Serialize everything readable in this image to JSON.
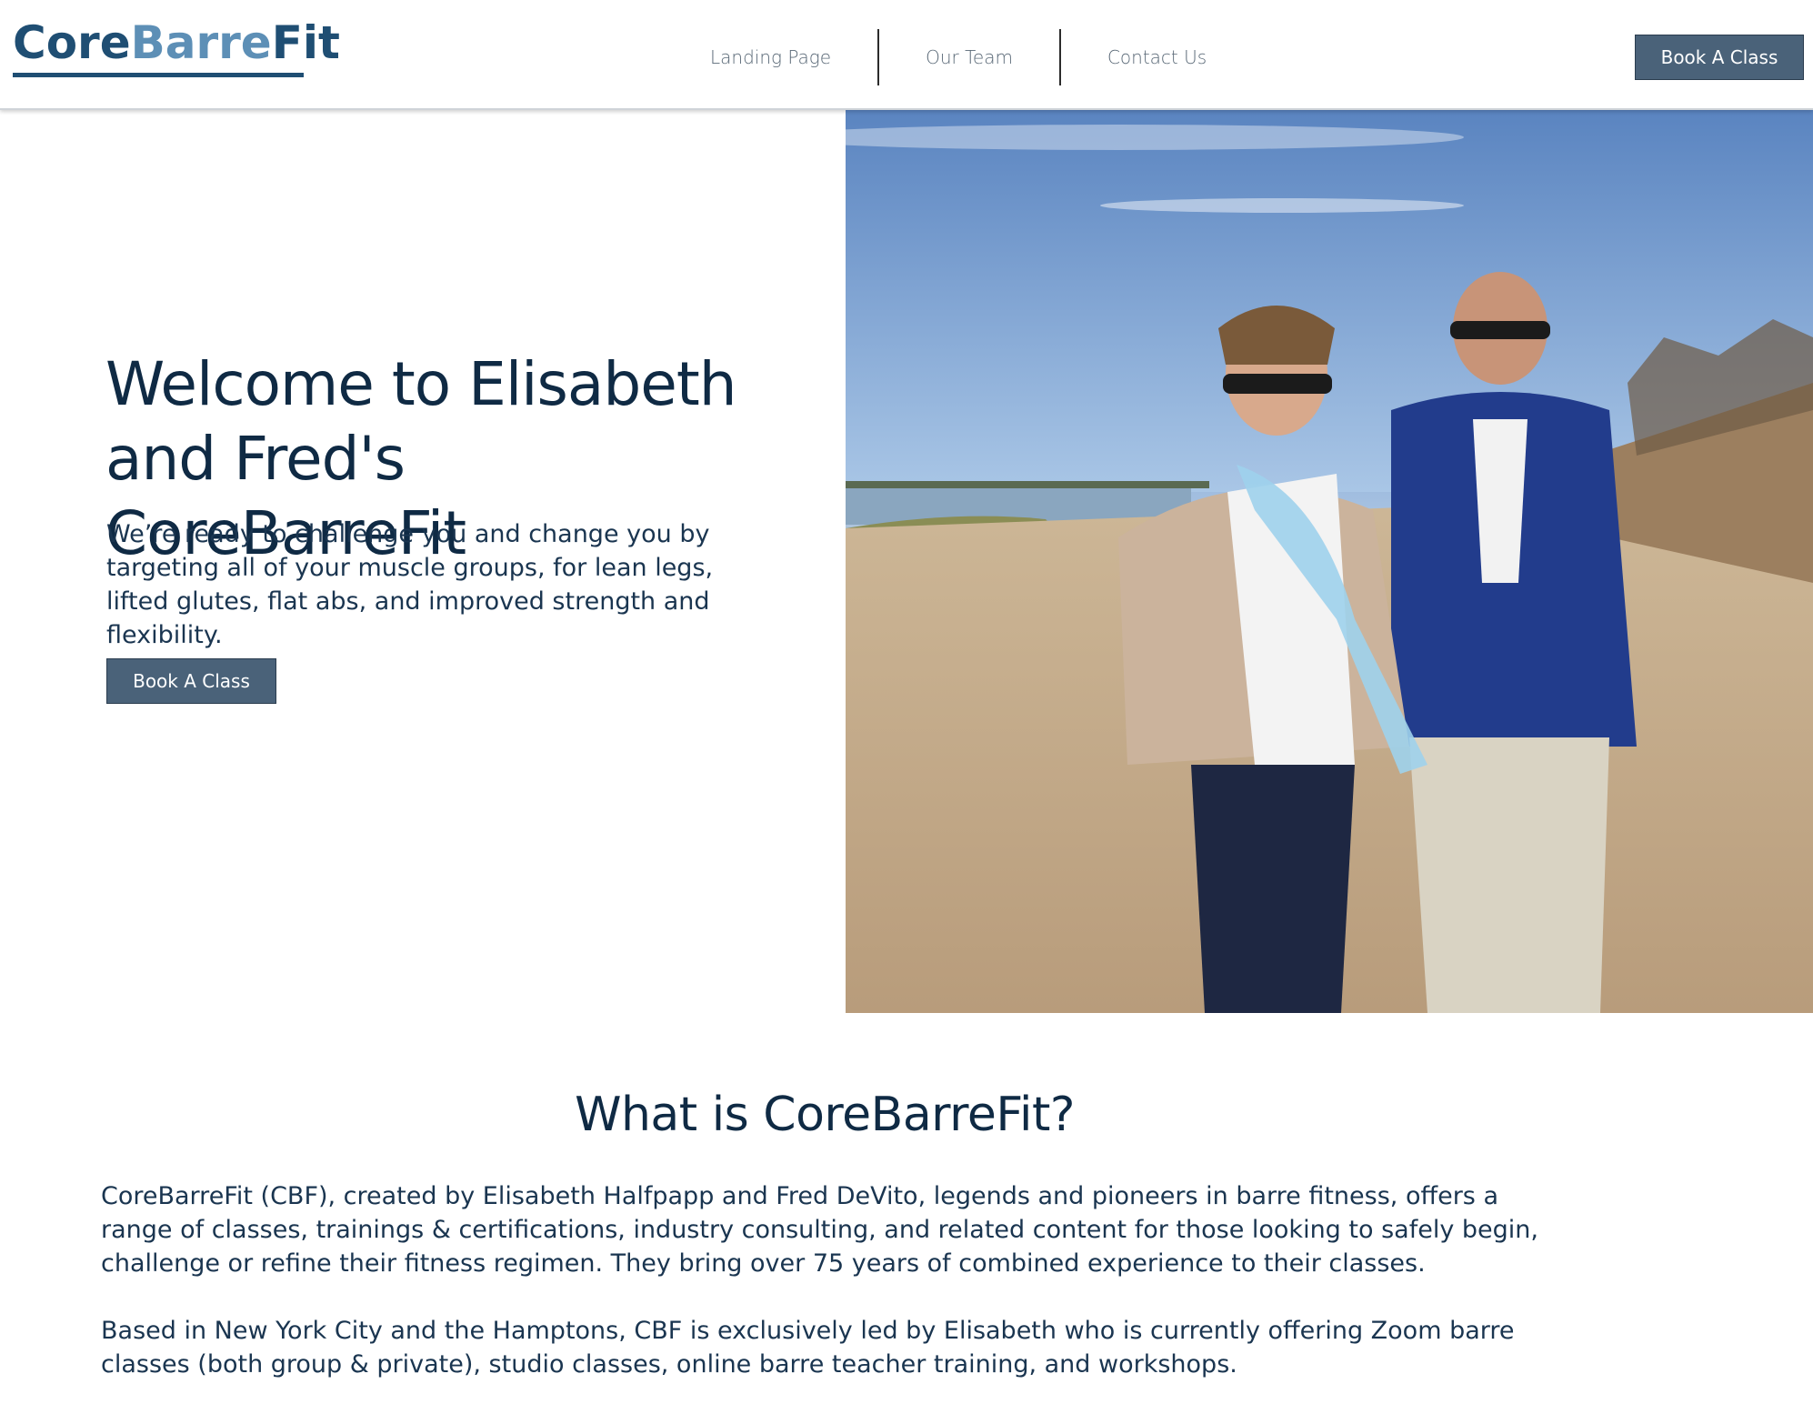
{
  "brand": {
    "logo_part1": "Core",
    "logo_part2": "Barre",
    "logo_part3": "Fit"
  },
  "nav": {
    "items": [
      {
        "label": "Landing Page"
      },
      {
        "label": "Our Team"
      },
      {
        "label": "Contact Us"
      }
    ],
    "book_label": "Book A Class"
  },
  "hero": {
    "title": "Welcome to Elisabeth and Fred's CoreBarreFit",
    "subtitle": "We’re ready to challenge you and change you by targeting all of your muscle groups, for lean legs, lifted glutes, flat abs, and improved strength and flexibility.",
    "book_label": "Book A Class"
  },
  "about": {
    "title": "What is CoreBarreFit?",
    "paragraph1": "CoreBarreFit (CBF), created by Elisabeth Halfpapp and Fred DeVito, legends and pioneers in barre fitness, offers a range of classes, trainings & certifications, industry consulting, and related content for those looking to safely begin, challenge or refine their fitness regimen. They bring over 75 years of combined experience to their classes.",
    "paragraph2": "Based in New York City and the Hamptons, CBF is exclusively led by Elisabeth who is currently offering Zoom barre classes (both group & private), studio classes, online barre teacher training, and workshops."
  }
}
